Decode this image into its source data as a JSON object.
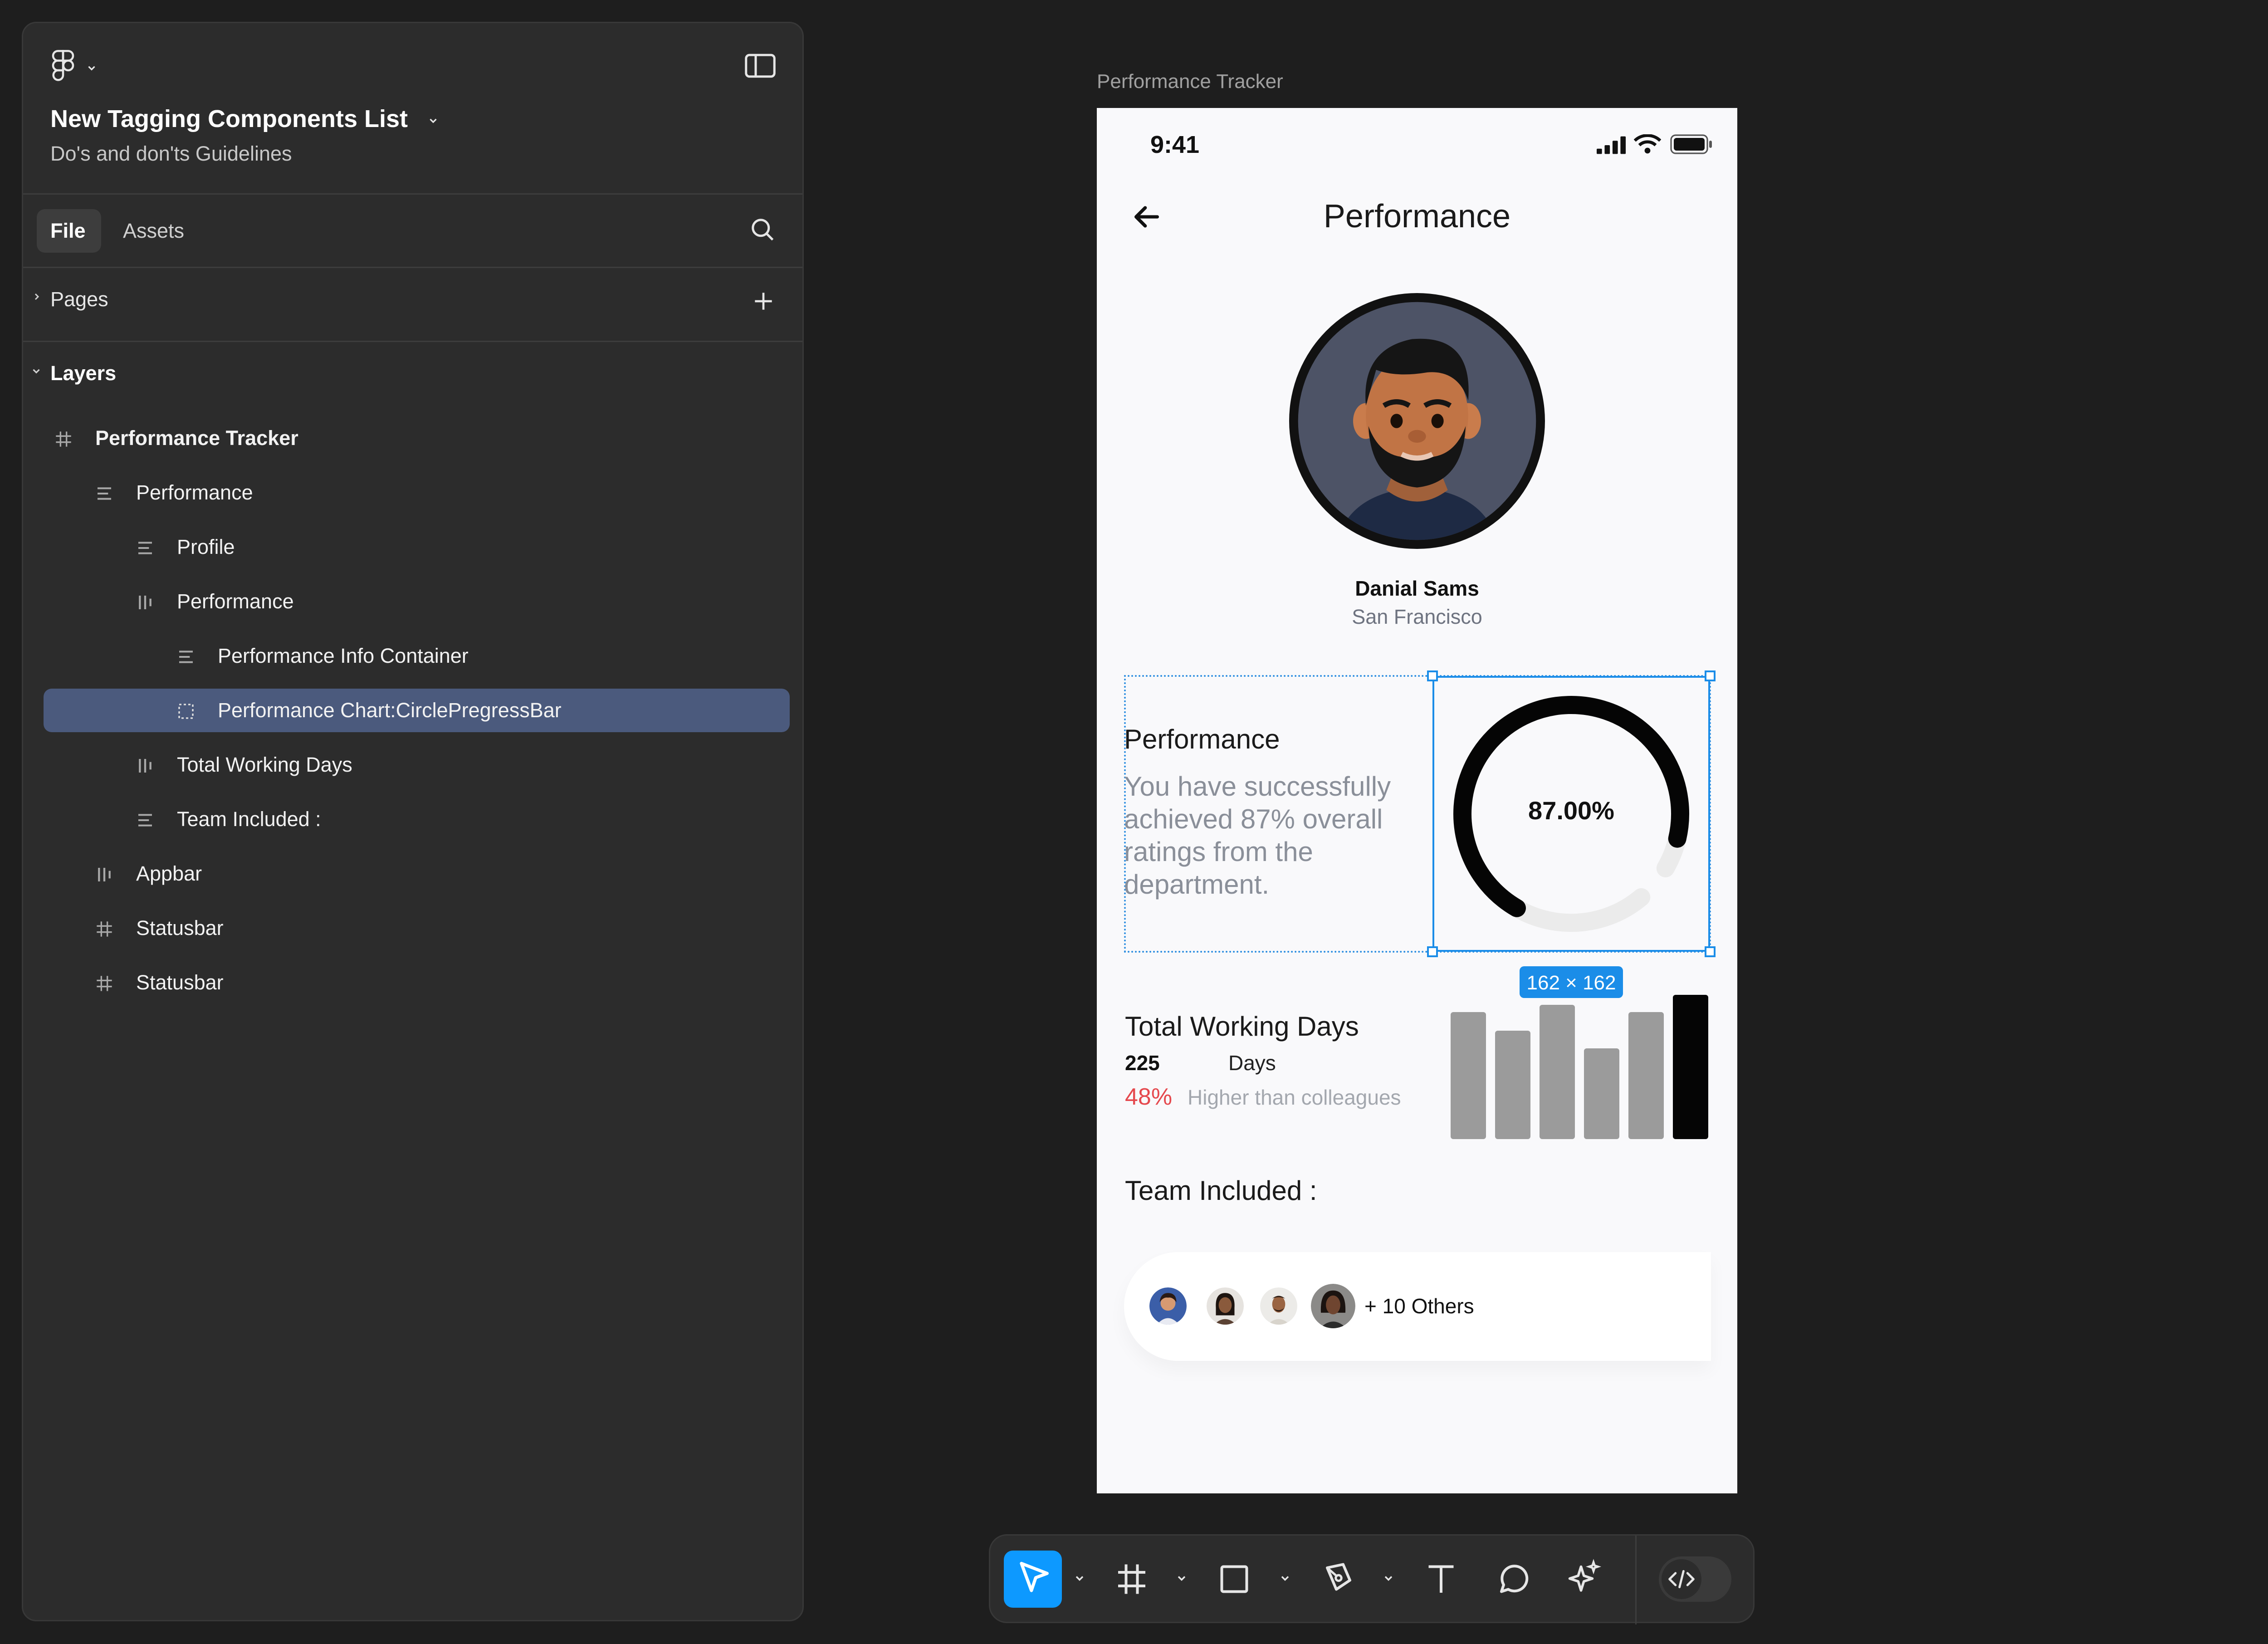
{
  "panel": {
    "file_title": "New Tagging Components List",
    "file_subtitle": "Do's and don'ts Guidelines",
    "tabs": [
      {
        "label": "File",
        "active": true
      },
      {
        "label": "Assets",
        "active": false
      }
    ],
    "pages_label": "Pages",
    "layers_label": "Layers",
    "layers": [
      {
        "label": "Performance Tracker",
        "icon": "frame-icon",
        "depth": 0,
        "bold": true,
        "selected": false
      },
      {
        "label": "Performance",
        "icon": "text-align-icon",
        "depth": 1,
        "bold": false,
        "selected": false
      },
      {
        "label": "Profile",
        "icon": "text-align-icon",
        "depth": 2,
        "bold": false,
        "selected": false
      },
      {
        "label": "Performance",
        "icon": "column-layout-icon",
        "depth": 2,
        "bold": false,
        "selected": false
      },
      {
        "label": "Performance Info Container",
        "icon": "text-align-icon",
        "depth": 3,
        "bold": false,
        "selected": false
      },
      {
        "label": "Performance Chart:CirclePregressBar",
        "icon": "dashed-frame-icon",
        "depth": 3,
        "bold": false,
        "selected": true
      },
      {
        "label": "Total Working Days",
        "icon": "column-layout-icon",
        "depth": 2,
        "bold": false,
        "selected": false
      },
      {
        "label": "Team Included :",
        "icon": "text-align-icon",
        "depth": 2,
        "bold": false,
        "selected": false
      },
      {
        "label": "Appbar",
        "icon": "column-layout-icon",
        "depth": 1,
        "bold": false,
        "selected": false
      },
      {
        "label": "Statusbar",
        "icon": "frame-icon",
        "depth": 1,
        "bold": false,
        "selected": false
      },
      {
        "label": "Statusbar",
        "icon": "frame-icon",
        "depth": 1,
        "bold": false,
        "selected": false
      }
    ]
  },
  "canvas": {
    "frame_label": "Performance Tracker",
    "selection_size": "162 × 162"
  },
  "phone": {
    "status_time": "9:41",
    "appbar_title": "Performance",
    "profile": {
      "name": "Danial Sams",
      "location": "San Francisco"
    },
    "performance": {
      "title": "Performance",
      "description": "You have successfully achieved 87% overall ratings from the department.",
      "percent_label": "87.00%",
      "progress": 0.87
    },
    "working_days": {
      "title": "Total Working Days",
      "count": "225",
      "unit": "Days",
      "percent": "48%",
      "comparison": "Higher than colleagues",
      "bars": [
        0.88,
        0.75,
        0.93,
        0.63,
        0.88,
        1.0
      ]
    },
    "team": {
      "title": "Team Included :",
      "others": "+ 10 Others"
    }
  },
  "colors": {
    "panel_bg": "#2c2c2c",
    "selection": "#4b5a7d",
    "accent_blue": "#0d99ff",
    "red": "#e5484d"
  }
}
